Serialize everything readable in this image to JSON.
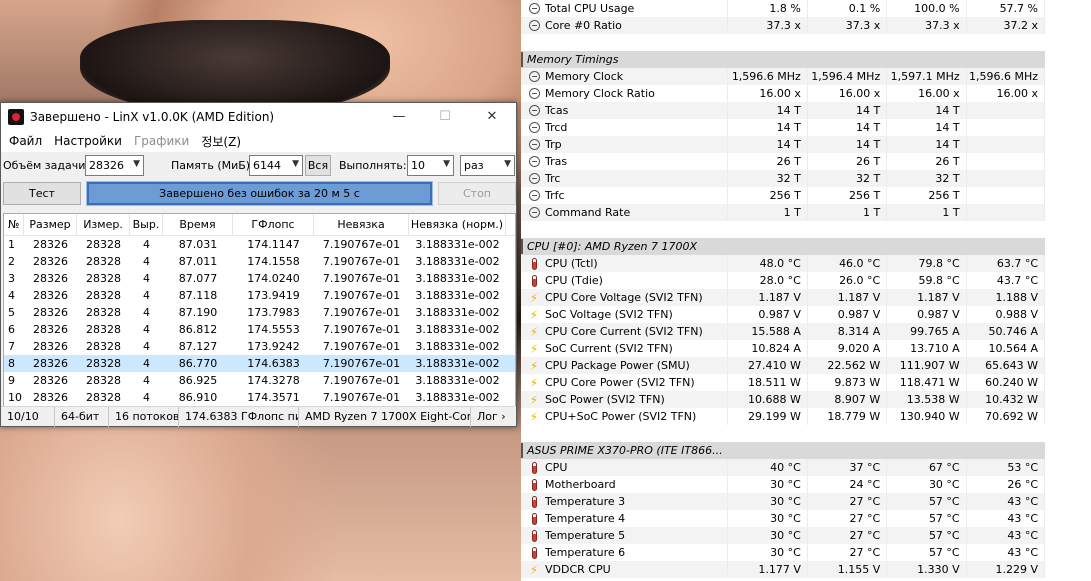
{
  "linx": {
    "title": "Завершено - LinX v1.0.0K (AMD Edition)",
    "window_buttons": {
      "minimize": "—",
      "maximize": "☐",
      "close": "✕"
    },
    "menu": [
      "Файл",
      "Настройки",
      "Графики",
      "정보(Z)"
    ],
    "options": {
      "size_label": "Объём задачи:",
      "size_value": "28326",
      "memory_label": "Память (МиБ):",
      "memory_value": "6144",
      "all_button": "Вся",
      "run_label": "Выполнять:",
      "run_value": "10",
      "unit_value": "раз"
    },
    "run": {
      "test_button": "Тест",
      "progress_percent": 100,
      "progress_text": "Завершено без ошибок за 20 м 5 с",
      "stop_button": "Стоп"
    },
    "table": {
      "columns": [
        "№",
        "Размер",
        "Измер.",
        "Выр.",
        "Время",
        "ГФлопс",
        "Невязка",
        "Невязка (норм.)"
      ],
      "rows": [
        [
          "1",
          "28326",
          "28328",
          "4",
          "87.031",
          "174.1147",
          "7.190767e-01",
          "3.188331e-002"
        ],
        [
          "2",
          "28326",
          "28328",
          "4",
          "87.011",
          "174.1558",
          "7.190767e-01",
          "3.188331e-002"
        ],
        [
          "3",
          "28326",
          "28328",
          "4",
          "87.077",
          "174.0240",
          "7.190767e-01",
          "3.188331e-002"
        ],
        [
          "4",
          "28326",
          "28328",
          "4",
          "87.118",
          "173.9419",
          "7.190767e-01",
          "3.188331e-002"
        ],
        [
          "5",
          "28326",
          "28328",
          "4",
          "87.190",
          "173.7983",
          "7.190767e-01",
          "3.188331e-002"
        ],
        [
          "6",
          "28326",
          "28328",
          "4",
          "86.812",
          "174.5553",
          "7.190767e-01",
          "3.188331e-002"
        ],
        [
          "7",
          "28326",
          "28328",
          "4",
          "87.127",
          "173.9242",
          "7.190767e-01",
          "3.188331e-002"
        ],
        [
          "8",
          "28326",
          "28328",
          "4",
          "86.770",
          "174.6383",
          "7.190767e-01",
          "3.188331e-002"
        ],
        [
          "9",
          "28326",
          "28328",
          "4",
          "86.925",
          "174.3278",
          "7.190767e-01",
          "3.188331e-002"
        ],
        [
          "10",
          "28326",
          "28328",
          "4",
          "86.910",
          "174.3571",
          "7.190767e-01",
          "3.188331e-002"
        ]
      ],
      "selected_row": 7
    },
    "status": [
      "10/10",
      "64-бит",
      "16 потоков",
      "174.6383 ГФлопс пик",
      "AMD Ryzen 7 1700X Eight-Core",
      "Лог ›"
    ]
  },
  "hwinfo": {
    "top_rows": [
      {
        "icon": "clock",
        "name": "Total CPU Usage",
        "values": [
          "1.8 %",
          "0.1 %",
          "100.0 %",
          "57.7 %"
        ]
      },
      {
        "icon": "clock",
        "name": "Core #0 Ratio",
        "values": [
          "37.3 x",
          "37.3 x",
          "37.3 x",
          "37.2 x"
        ]
      }
    ],
    "groups": [
      {
        "name": "Memory Timings",
        "rows": [
          {
            "icon": "clock",
            "name": "Memory Clock",
            "values": [
              "1,596.6 MHz",
              "1,596.4 MHz",
              "1,597.1 MHz",
              "1,596.6 MHz"
            ]
          },
          {
            "icon": "clock",
            "name": "Memory Clock Ratio",
            "values": [
              "16.00 x",
              "16.00 x",
              "16.00 x",
              "16.00 x"
            ]
          },
          {
            "icon": "clock",
            "name": "Tcas",
            "values": [
              "14 T",
              "14 T",
              "14 T",
              ""
            ]
          },
          {
            "icon": "clock",
            "name": "Trcd",
            "values": [
              "14 T",
              "14 T",
              "14 T",
              ""
            ]
          },
          {
            "icon": "clock",
            "name": "Trp",
            "values": [
              "14 T",
              "14 T",
              "14 T",
              ""
            ]
          },
          {
            "icon": "clock",
            "name": "Tras",
            "values": [
              "26 T",
              "26 T",
              "26 T",
              ""
            ]
          },
          {
            "icon": "clock",
            "name": "Trc",
            "values": [
              "32 T",
              "32 T",
              "32 T",
              ""
            ]
          },
          {
            "icon": "clock",
            "name": "Trfc",
            "values": [
              "256 T",
              "256 T",
              "256 T",
              ""
            ]
          },
          {
            "icon": "clock",
            "name": "Command Rate",
            "values": [
              "1 T",
              "1 T",
              "1 T",
              ""
            ]
          }
        ]
      },
      {
        "name": "CPU [#0]: AMD Ryzen 7 1700X",
        "rows": [
          {
            "icon": "therm",
            "name": "CPU (Tctl)",
            "values": [
              "48.0 °C",
              "46.0 °C",
              "79.8 °C",
              "63.7 °C"
            ]
          },
          {
            "icon": "therm",
            "name": "CPU (Tdie)",
            "values": [
              "28.0 °C",
              "26.0 °C",
              "59.8 °C",
              "43.7 °C"
            ]
          },
          {
            "icon": "bolt",
            "name": "CPU Core Voltage (SVI2 TFN)",
            "values": [
              "1.187 V",
              "1.187 V",
              "1.187 V",
              "1.188 V"
            ]
          },
          {
            "icon": "bolt",
            "name": "SoC Voltage (SVI2 TFN)",
            "values": [
              "0.987 V",
              "0.987 V",
              "0.987 V",
              "0.988 V"
            ]
          },
          {
            "icon": "bolt",
            "name": "CPU Core Current (SVI2 TFN)",
            "values": [
              "15.588 A",
              "8.314 A",
              "99.765 A",
              "50.746 A"
            ]
          },
          {
            "icon": "bolt",
            "name": "SoC Current (SVI2 TFN)",
            "values": [
              "10.824 A",
              "9.020 A",
              "13.710 A",
              "10.564 A"
            ]
          },
          {
            "icon": "bolt",
            "name": "CPU Package Power (SMU)",
            "values": [
              "27.410 W",
              "22.562 W",
              "111.907 W",
              "65.643 W"
            ]
          },
          {
            "icon": "bolt",
            "name": "CPU Core Power (SVI2 TFN)",
            "values": [
              "18.511 W",
              "9.873 W",
              "118.471 W",
              "60.240 W"
            ]
          },
          {
            "icon": "bolt",
            "name": "SoC Power (SVI2 TFN)",
            "values": [
              "10.688 W",
              "8.907 W",
              "13.538 W",
              "10.432 W"
            ]
          },
          {
            "icon": "bolt",
            "name": "CPU+SoC Power (SVI2 TFN)",
            "values": [
              "29.199 W",
              "18.779 W",
              "130.940 W",
              "70.692 W"
            ]
          }
        ]
      },
      {
        "name": "ASUS PRIME X370-PRO (ITE IT866...",
        "rows": [
          {
            "icon": "therm",
            "name": "CPU",
            "values": [
              "40 °C",
              "37 °C",
              "67 °C",
              "53 °C"
            ]
          },
          {
            "icon": "therm",
            "name": "Motherboard",
            "values": [
              "30 °C",
              "24 °C",
              "30 °C",
              "26 °C"
            ]
          },
          {
            "icon": "therm",
            "name": "Temperature 3",
            "values": [
              "30 °C",
              "27 °C",
              "57 °C",
              "43 °C"
            ]
          },
          {
            "icon": "therm",
            "name": "Temperature 4",
            "values": [
              "30 °C",
              "27 °C",
              "57 °C",
              "43 °C"
            ]
          },
          {
            "icon": "therm",
            "name": "Temperature 5",
            "values": [
              "30 °C",
              "27 °C",
              "57 °C",
              "43 °C"
            ]
          },
          {
            "icon": "therm",
            "name": "Temperature 6",
            "values": [
              "30 °C",
              "27 °C",
              "57 °C",
              "43 °C"
            ]
          },
          {
            "icon": "bolt",
            "name": "VDDCR CPU",
            "values": [
              "1.177 V",
              "1.155 V",
              "1.330 V",
              "1.229 V"
            ]
          }
        ]
      }
    ]
  }
}
